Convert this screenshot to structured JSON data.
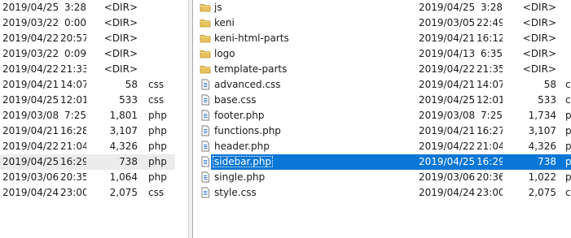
{
  "left_pane": {
    "rows": [
      {
        "date": "2019/04/25",
        "time": "3:28",
        "size": "<DIR>",
        "ext": ""
      },
      {
        "date": "2019/03/22",
        "time": "0:00",
        "size": "<DIR>",
        "ext": ""
      },
      {
        "date": "2019/04/22",
        "time": "20:57",
        "size": "<DIR>",
        "ext": ""
      },
      {
        "date": "2019/03/22",
        "time": "0:09",
        "size": "<DIR>",
        "ext": ""
      },
      {
        "date": "2019/04/22",
        "time": "21:33",
        "size": "<DIR>",
        "ext": ""
      },
      {
        "date": "2019/04/21",
        "time": "14:07",
        "size": "58",
        "ext": "css"
      },
      {
        "date": "2019/04/25",
        "time": "12:01",
        "size": "533",
        "ext": "css"
      },
      {
        "date": "2019/03/08",
        "time": "7:25",
        "size": "1,801",
        "ext": "php"
      },
      {
        "date": "2019/04/21",
        "time": "16:28",
        "size": "3,107",
        "ext": "php"
      },
      {
        "date": "2019/04/22",
        "time": "21:04",
        "size": "4,326",
        "ext": "php"
      },
      {
        "date": "2019/04/25",
        "time": "16:29",
        "size": "738",
        "ext": "php",
        "selected": true
      },
      {
        "date": "2019/03/06",
        "time": "20:35",
        "size": "1,064",
        "ext": "php"
      },
      {
        "date": "2019/04/24",
        "time": "23:00",
        "size": "2,075",
        "ext": "css"
      }
    ]
  },
  "right_pane": {
    "rows": [
      {
        "icon": "folder-icon",
        "name": "js",
        "date": "2019/04/25",
        "time": "3:28",
        "size": "<DIR>",
        "ext": ""
      },
      {
        "icon": "folder-icon",
        "name": "keni",
        "date": "2019/03/05",
        "time": "22:49",
        "size": "<DIR>",
        "ext": ""
      },
      {
        "icon": "folder-icon",
        "name": "keni-html-parts",
        "date": "2019/04/21",
        "time": "16:12",
        "size": "<DIR>",
        "ext": ""
      },
      {
        "icon": "folder-icon",
        "name": "logo",
        "date": "2019/04/13",
        "time": "6:35",
        "size": "<DIR>",
        "ext": ""
      },
      {
        "icon": "folder-icon",
        "name": "template-parts",
        "date": "2019/04/22",
        "time": "21:35",
        "size": "<DIR>",
        "ext": ""
      },
      {
        "icon": "file-icon",
        "name": "advanced.css",
        "date": "2019/04/21",
        "time": "14:07",
        "size": "58",
        "ext": "c"
      },
      {
        "icon": "file-icon",
        "name": "base.css",
        "date": "2019/04/25",
        "time": "12:01",
        "size": "533",
        "ext": "c"
      },
      {
        "icon": "file-icon",
        "name": "footer.php",
        "date": "2019/03/08",
        "time": "7:25",
        "size": "1,734",
        "ext": "p"
      },
      {
        "icon": "file-icon",
        "name": "functions.php",
        "date": "2019/04/21",
        "time": "16:27",
        "size": "3,107",
        "ext": "p"
      },
      {
        "icon": "file-icon",
        "name": "header.php",
        "date": "2019/04/22",
        "time": "21:04",
        "size": "4,326",
        "ext": "p"
      },
      {
        "icon": "file-icon",
        "name": "sidebar.php",
        "date": "2019/04/25",
        "time": "16:29",
        "size": "738",
        "ext": "p",
        "selected": true
      },
      {
        "icon": "file-icon",
        "name": "single.php",
        "date": "2019/03/06",
        "time": "20:36",
        "size": "1,022",
        "ext": "p"
      },
      {
        "icon": "file-icon",
        "name": "style.css",
        "date": "2019/04/24",
        "time": "23:00",
        "size": "2,075",
        "ext": "c"
      }
    ]
  },
  "colors": {
    "selection_right": "#0a76d6",
    "selection_left": "#ececec",
    "folder": "#e8c25a",
    "file_icon_lines": "#3b7ad9"
  }
}
